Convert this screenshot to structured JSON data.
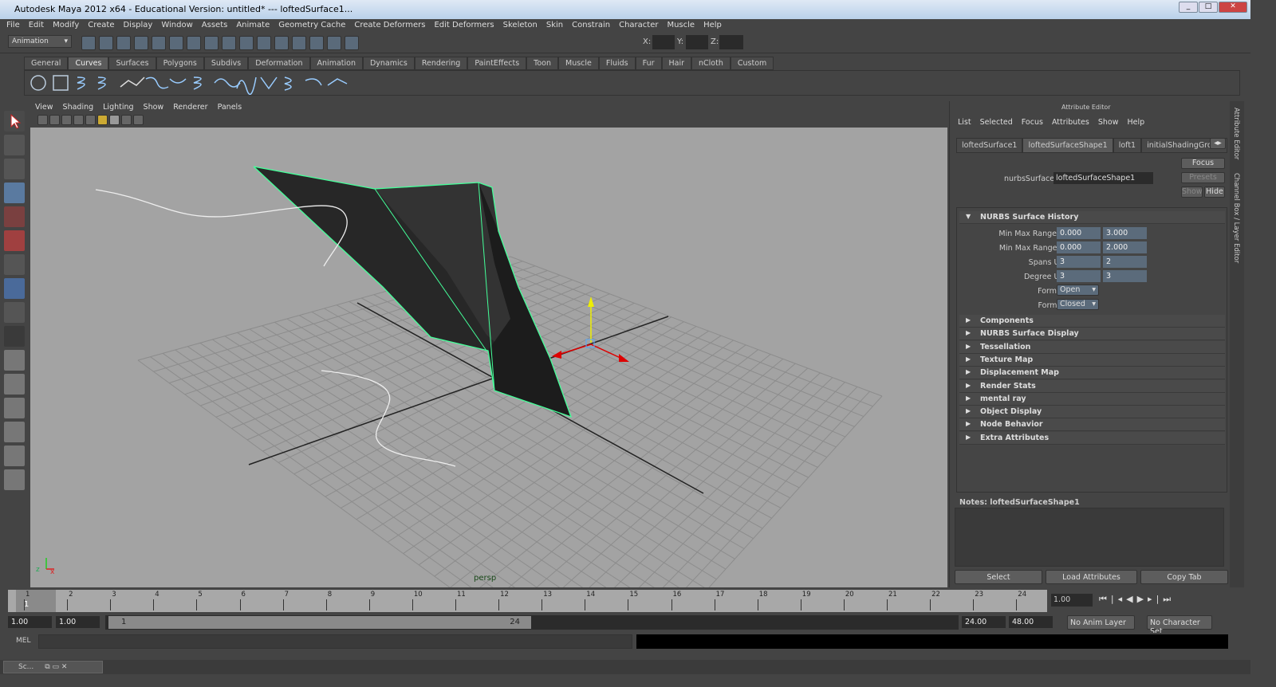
{
  "window": {
    "title": "Autodesk Maya 2012 x64 - Educational Version: untitled*  ---  loftedSurface1...",
    "controls": [
      "_",
      "□",
      "✕"
    ]
  },
  "menubar": [
    "File",
    "Edit",
    "Modify",
    "Create",
    "Display",
    "Window",
    "Assets",
    "Animate",
    "Geometry Cache",
    "Create Deformers",
    "Edit Deformers",
    "Skeleton",
    "Skin",
    "Constrain",
    "Character",
    "Muscle",
    "Help"
  ],
  "statusline": {
    "menu_set": "Animation",
    "x_label": "X:",
    "y_label": "Y:",
    "z_label": "Z:"
  },
  "shelf_tabs": [
    "General",
    "Curves",
    "Surfaces",
    "Polygons",
    "Subdivs",
    "Deformation",
    "Animation",
    "Dynamics",
    "Rendering",
    "PaintEffects",
    "Toon",
    "Muscle",
    "Fluids",
    "Fur",
    "Hair",
    "nCloth",
    "Custom"
  ],
  "shelf_active": "Curves",
  "viewport": {
    "menu": [
      "View",
      "Shading",
      "Lighting",
      "Show",
      "Renderer",
      "Panels"
    ],
    "camera_label": "persp",
    "axis_labels": {
      "x": "x",
      "y": "y",
      "z": "z"
    },
    "colors": {
      "background": "#a3a3a3",
      "surface": "#262626",
      "highlight": "#44ff99"
    }
  },
  "attribute_editor": {
    "title": "Attribute Editor",
    "menu": [
      "List",
      "Selected",
      "Focus",
      "Attributes",
      "Show",
      "Help"
    ],
    "tabs": [
      "loftedSurface1",
      "loftedSurfaceShape1",
      "loft1",
      "initialShadingGroup"
    ],
    "active_tab": "loftedSurfaceShape1",
    "node_label": "nurbsSurface:",
    "node_value": "loftedSurfaceShape1",
    "buttons": {
      "focus": "Focus",
      "presets": "Presets",
      "show": "Show",
      "hide": "Hide"
    },
    "history_section": "NURBS Surface History",
    "fields": [
      {
        "label": "Min Max Range U",
        "a": "0.000",
        "b": "3.000"
      },
      {
        "label": "Min Max Range V",
        "a": "0.000",
        "b": "2.000"
      },
      {
        "label": "Spans UV",
        "a": "3",
        "b": "2"
      },
      {
        "label": "Degree UV",
        "a": "3",
        "b": "3"
      }
    ],
    "form_u": {
      "label": "Form U",
      "value": "Open"
    },
    "form_v": {
      "label": "Form V",
      "value": "Closed"
    },
    "sections": [
      "Components",
      "NURBS Surface Display",
      "Tessellation",
      "Texture Map",
      "Displacement Map",
      "Render Stats",
      "mental ray",
      "Object Display",
      "Node Behavior",
      "Extra Attributes"
    ],
    "notes": "Notes:  loftedSurfaceShape1",
    "bottom_buttons": [
      "Select",
      "Load Attributes",
      "Copy Tab"
    ]
  },
  "side_tabs": [
    "Attribute Editor",
    "Channel Box / Layer Editor"
  ],
  "timeline": {
    "ticks": [
      "1",
      "2",
      "3",
      "4",
      "5",
      "6",
      "7",
      "8",
      "9",
      "10",
      "11",
      "12",
      "13",
      "14",
      "15",
      "16",
      "17",
      "18",
      "19",
      "20",
      "21",
      "22",
      "23",
      "24"
    ],
    "current_frame_marker": "1",
    "current_time": "1.00"
  },
  "range": {
    "start": "1.00",
    "playback_start": "1.00",
    "slider_start": "1",
    "slider_end": "24",
    "playback_end": "24.00",
    "end": "48.00",
    "anim_layer": "No Anim Layer",
    "character_set": "No Character Set"
  },
  "command": {
    "label": "MEL"
  },
  "taskbar": {
    "item": "Sc..."
  }
}
